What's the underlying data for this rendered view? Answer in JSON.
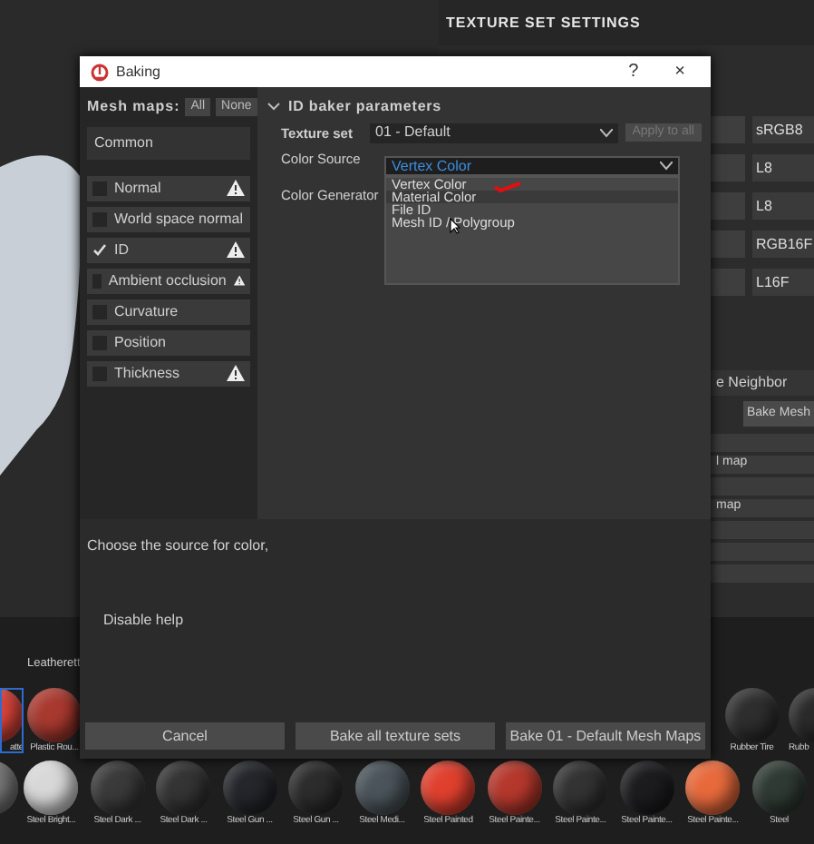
{
  "texture_set_settings": {
    "title": "TEXTURE SET SETTINGS",
    "formats": [
      "sRGB8",
      "L8",
      "L8",
      "RGB16F",
      "L16F"
    ],
    "neighbor_text": "e Neighbor",
    "bake_button": "Bake Mesh",
    "map_rows": [
      "",
      "l map",
      "",
      "map",
      "",
      "",
      ""
    ]
  },
  "shelf": {
    "row_top_labels": [
      "Leatherett"
    ],
    "row1_left": [
      {
        "label": "atte",
        "selected": true,
        "color": "#d9443a"
      },
      {
        "label": "Plastic Rou...",
        "selected": false,
        "color": "#a8392f"
      }
    ],
    "row1_right": [
      {
        "label": "Rubber Tire",
        "selected": false,
        "color": "#2e2e2e"
      },
      {
        "label": "Rubb",
        "selected": false,
        "color": "#2a2a2a"
      }
    ],
    "row2": [
      {
        "selected": false,
        "color": "#777777"
      },
      {
        "label": "Steel Bright...",
        "selected": false,
        "color": "#d8d8d8"
      },
      {
        "label": "Steel Dark ...",
        "selected": false,
        "color": "#3a3a3a"
      },
      {
        "label": "Steel Dark ...",
        "selected": false,
        "color": "#343434"
      },
      {
        "label": "Steel Gun ...",
        "selected": false,
        "color": "#24262b"
      },
      {
        "label": "Steel Gun ...",
        "selected": false,
        "color": "#2c2c2c"
      },
      {
        "label": "Steel Medi...",
        "selected": false,
        "color": "#4a545a"
      },
      {
        "label": "Steel Painted",
        "selected": false,
        "color": "#e0402e"
      },
      {
        "label": "Steel Painte...",
        "selected": false,
        "color": "#b5382c"
      },
      {
        "label": "Steel Painte...",
        "selected": false,
        "color": "#333333"
      },
      {
        "label": "Steel Painte...",
        "selected": false,
        "color": "#1c1c1f"
      },
      {
        "label": "Steel Painte...",
        "selected": false,
        "color": "#e86a3c"
      },
      {
        "label": "Steel",
        "selected": false,
        "color": "#2f3a34"
      }
    ]
  },
  "dialog": {
    "title": "Baking",
    "help": "?",
    "close": "×",
    "mesh_maps_label": "Mesh maps:",
    "all_button": "All",
    "none_button": "None",
    "group": "Common",
    "maps": [
      {
        "label": "Normal",
        "checked": false,
        "warning": true
      },
      {
        "label": "World space normal",
        "checked": false,
        "warning": false
      },
      {
        "label": "ID",
        "checked": true,
        "warning": true
      },
      {
        "label": "Ambient occlusion",
        "checked": false,
        "warning": true
      },
      {
        "label": "Curvature",
        "checked": false,
        "warning": false
      },
      {
        "label": "Position",
        "checked": false,
        "warning": false
      },
      {
        "label": "Thickness",
        "checked": false,
        "warning": true
      }
    ],
    "section": "ID baker parameters",
    "section_expanded": true,
    "texture_set_label": "Texture set",
    "texture_set_value": "01 - Default",
    "apply_button": "Apply to all",
    "apply_disabled": true,
    "color_source_label": "Color Source",
    "color_source_value": "Vertex Color",
    "options": [
      {
        "label": "Vertex Color",
        "selected": false
      },
      {
        "label": "Material Color",
        "selected": true
      },
      {
        "label": "File ID",
        "selected": false
      },
      {
        "label": "Mesh ID / Polygroup",
        "selected": false
      }
    ],
    "color_generator_label": "Color Generator",
    "help_text": "Choose the source for color,",
    "disable_help": "Disable help",
    "buttons": [
      "Cancel",
      "Bake all texture sets",
      "Bake 01 - Default Mesh Maps"
    ]
  }
}
